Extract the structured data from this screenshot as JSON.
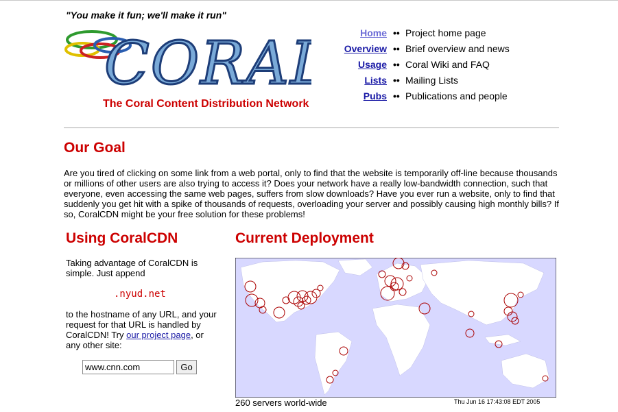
{
  "header": {
    "tagline": "\"You make it fun; we'll make it run\"",
    "logo_text": "CORAL",
    "subtitle": "The Coral Content Distribution Network"
  },
  "nav": [
    {
      "label": "Home",
      "desc": "Project home page",
      "visited": true
    },
    {
      "label": "Overview",
      "desc": "Brief overview and news",
      "visited": false
    },
    {
      "label": "Usage",
      "desc": "Coral Wiki and FAQ",
      "visited": false
    },
    {
      "label": "Lists",
      "desc": "Mailing Lists",
      "visited": false
    },
    {
      "label": "Pubs",
      "desc": "Publications and people",
      "visited": false
    }
  ],
  "nav_separator": "••",
  "goal": {
    "heading": "Our Goal",
    "text": "Are you tired of clicking on some link from a web portal, only to find that the website is temporarily off-line because thousands or millions of other users are also trying to access it? Does your network have a really low-bandwidth connection, such that everyone, even accessing the same web pages, suffers from slow downloads? Have you ever run a website, only to find that suddenly you get hit with a spike of thousands of requests, overloading your server and possibly causing high monthly bills? If so, CoralCDN might be your free solution for these problems!"
  },
  "using": {
    "heading": "Using CoralCDN",
    "intro": "Taking advantage of CoralCDN is simple. Just append",
    "code": ".nyud.net",
    "text_before_link": "to the hostname of any URL, and your request for that URL is handled by CoralCDN! Try ",
    "link": "our project page",
    "text_after_link": ", or any other site:",
    "input_value": "www.cnn.com",
    "go_label": "Go"
  },
  "deployment": {
    "heading": "Current Deployment",
    "servers": "260 servers world-wide",
    "timestamp": "Thu Jun 16 17:43:08 EDT 2005"
  },
  "colors": {
    "accent_red": "#cc0000",
    "link_blue": "#1a1aa6",
    "ocean": "#d8d8ff",
    "marker": "#aa0000"
  }
}
